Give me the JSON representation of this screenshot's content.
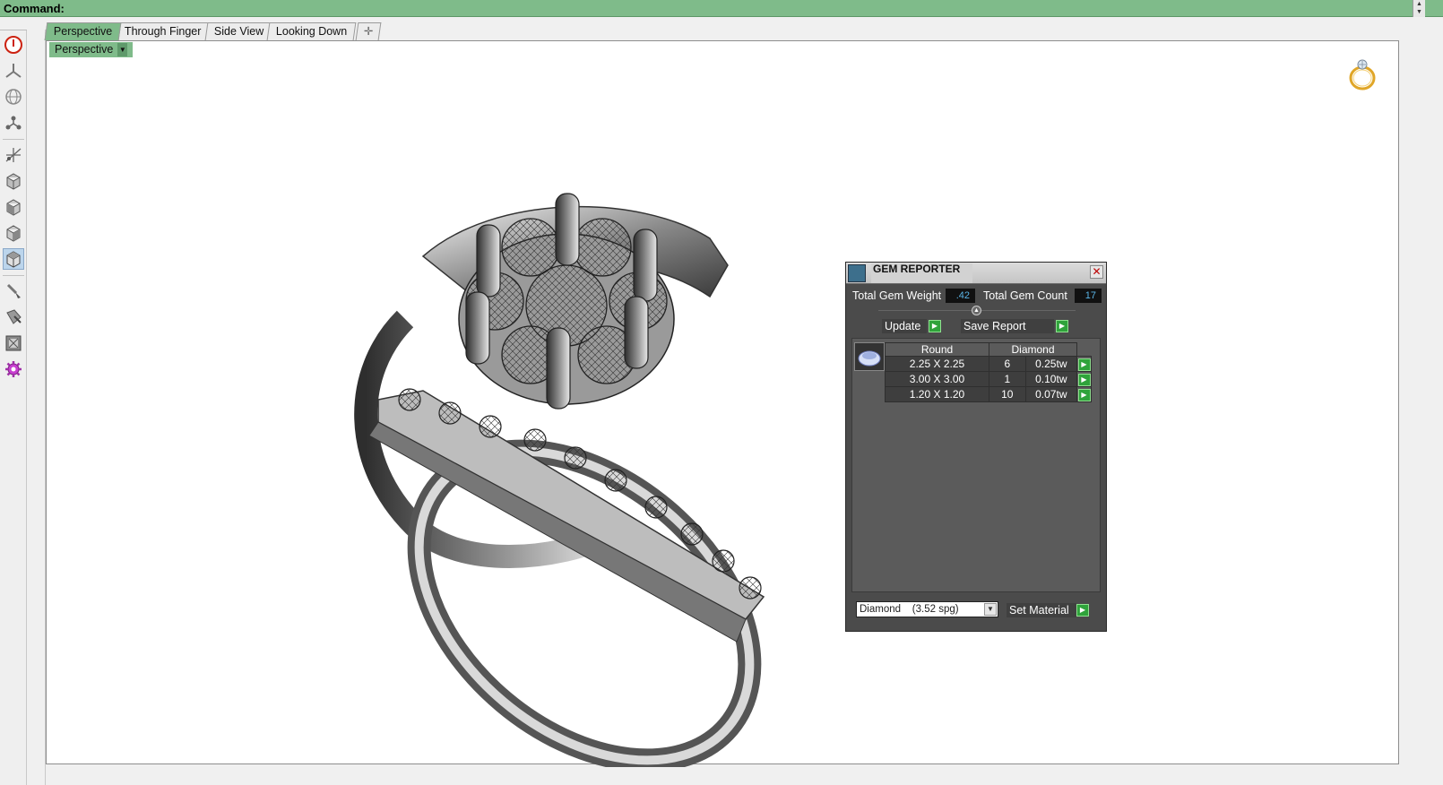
{
  "command": {
    "label": "Command:"
  },
  "tabs": [
    {
      "label": "Perspective",
      "active": true
    },
    {
      "label": "Through Finger",
      "active": false
    },
    {
      "label": "Side View",
      "active": false
    },
    {
      "label": "Looking Down",
      "active": false
    }
  ],
  "add_tab_icon": "plus-icon",
  "viewport": {
    "label": "Perspective"
  },
  "toolbar": {
    "icons": [
      "power-icon",
      "axis-icon",
      "globe-icon",
      "node-icon",
      "transform-icon",
      "cube-icon",
      "cube-front-icon",
      "cube-side-icon",
      "cube-top-icon",
      "brush-icon",
      "paint-icon",
      "frame-icon",
      "gear-icon"
    ],
    "active_index": 8
  },
  "gem_reporter": {
    "title": "GEM REPORTER",
    "total_weight_label": "Total Gem Weight",
    "total_weight_value": ".42",
    "total_count_label": "Total Gem Count",
    "total_count_value": "17",
    "update_label": "Update",
    "save_label": "Save Report",
    "table": {
      "headers": [
        "Round",
        "Diamond"
      ],
      "rows": [
        {
          "size": "2.25 X 2.25",
          "count": "6",
          "weight": "0.25tw"
        },
        {
          "size": "3.00 X 3.00",
          "count": "1",
          "weight": "0.10tw"
        },
        {
          "size": "1.20 X 1.20",
          "count": "10",
          "weight": "0.07tw"
        }
      ]
    },
    "material_value": "Diamond    (3.52 spg)",
    "set_material_label": "Set Material"
  },
  "colors": {
    "accent_green": "#7fbb8a",
    "button_green": "#2fa33b",
    "panel_dark": "#4b4b4b",
    "value_blue": "#5ab4e6"
  }
}
